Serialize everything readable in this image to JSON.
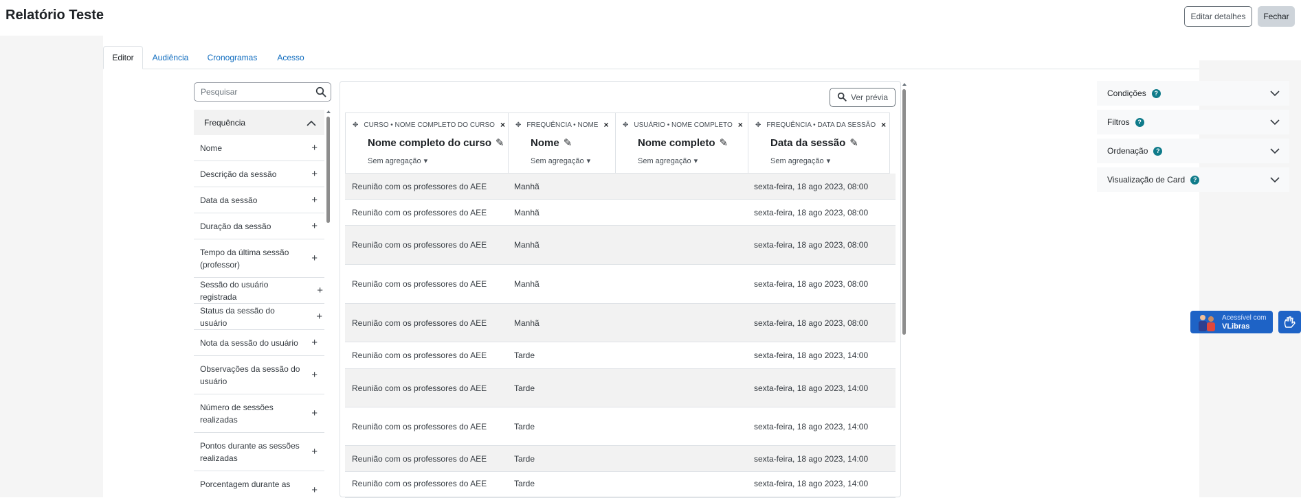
{
  "page": {
    "title": "Relatório Teste",
    "edit_details": "Editar detalhes",
    "close": "Fechar"
  },
  "tabs": [
    {
      "label": "Editor",
      "active": true
    },
    {
      "label": "Audiência",
      "active": false
    },
    {
      "label": "Cronogramas",
      "active": false
    },
    {
      "label": "Acesso",
      "active": false
    }
  ],
  "sidebar": {
    "search_placeholder": "Pesquisar",
    "group_title": "Frequência",
    "items": [
      "Nome",
      "Descrição da sessão",
      "Data da sessão",
      "Duração da sessão",
      "Tempo da última sessão (professor)",
      "Sessão do usuário registrada",
      "Status da sessão do usuário",
      "Nota da sessão do usuário",
      "Observações da sessão do usuário",
      "Número de sessões realizadas",
      "Pontos durante as sessões realizadas",
      "Porcentagem durante as"
    ]
  },
  "preview_button": "Ver prévia",
  "columns": [
    {
      "meta": "CURSO • NOME COMPLETO DO CURSO",
      "name": "Nome completo do curso",
      "agg": "Sem agregação"
    },
    {
      "meta": "FREQUÊNCIA • NOME",
      "name": "Nome",
      "agg": "Sem agregação"
    },
    {
      "meta": "USUÁRIO • NOME COMPLETO",
      "name": "Nome completo",
      "agg": "Sem agregação"
    },
    {
      "meta": "FREQUÊNCIA • DATA DA SESSÃO",
      "name": "Data da sessão",
      "agg": "Sem agregação"
    }
  ],
  "rows": [
    {
      "curso": "Reunião com os professores do AEE",
      "nome": "Manhã",
      "usuario": "",
      "data": "sexta-feira, 18 ago 2023, 08:00"
    },
    {
      "curso": "Reunião com os professores do AEE",
      "nome": "Manhã",
      "usuario": "",
      "data": "sexta-feira, 18 ago 2023, 08:00"
    },
    {
      "curso": "Reunião com os professores do AEE",
      "nome": "Manhã",
      "usuario": "",
      "data": "sexta-feira, 18 ago 2023, 08:00"
    },
    {
      "curso": "Reunião com os professores do AEE",
      "nome": "Manhã",
      "usuario": "",
      "data": "sexta-feira, 18 ago 2023, 08:00"
    },
    {
      "curso": "Reunião com os professores do AEE",
      "nome": "Manhã",
      "usuario": "",
      "data": "sexta-feira, 18 ago 2023, 08:00"
    },
    {
      "curso": "Reunião com os professores do AEE",
      "nome": "Tarde",
      "usuario": "",
      "data": "sexta-feira, 18 ago 2023, 14:00"
    },
    {
      "curso": "Reunião com os professores do AEE",
      "nome": "Tarde",
      "usuario": "",
      "data": "sexta-feira, 18 ago 2023, 14:00"
    },
    {
      "curso": "Reunião com os professores do AEE",
      "nome": "Tarde",
      "usuario": "",
      "data": "sexta-feira, 18 ago 2023, 14:00"
    },
    {
      "curso": "Reunião com os professores do AEE",
      "nome": "Tarde",
      "usuario": "",
      "data": "sexta-feira, 18 ago 2023, 14:00"
    },
    {
      "curso": "Reunião com os professores do AEE",
      "nome": "Tarde",
      "usuario": "",
      "data": "sexta-feira, 18 ago 2023, 14:00"
    }
  ],
  "accordions": [
    {
      "label": "Condições"
    },
    {
      "label": "Filtros"
    },
    {
      "label": "Ordenação"
    },
    {
      "label": "Visualização de Card"
    }
  ],
  "help_glyph": "?",
  "vlibras": {
    "line1": "Acessível com",
    "line2": "VLibras"
  },
  "colors": {
    "link": "#0f6cbf",
    "help": "#0f7b8a",
    "vlibras": "#1e63c6"
  }
}
